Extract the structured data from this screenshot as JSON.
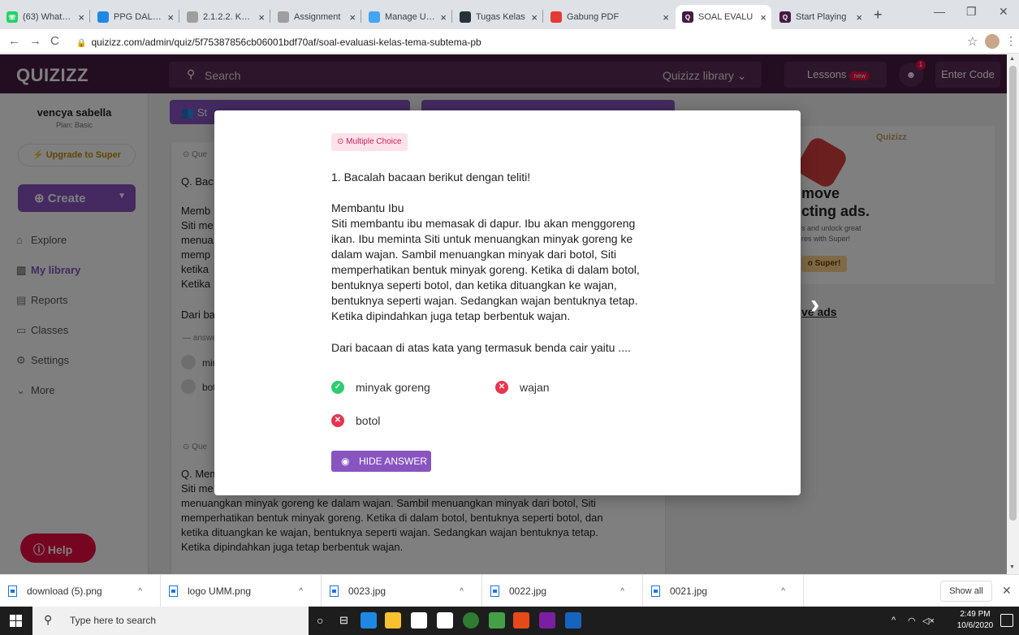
{
  "browser": {
    "tabs": [
      {
        "title": "(63) WhatsAp",
        "color": "#25d366"
      },
      {
        "title": "PPG DALJAB",
        "color": "#1e88e5"
      },
      {
        "title": "2.1.2.2. Konel",
        "color": "#9e9e9e"
      },
      {
        "title": "Assignment",
        "color": "#9e9e9e"
      },
      {
        "title": "Manage Uplo",
        "color": "#42a5f5"
      },
      {
        "title": "Tugas Kelas",
        "color": "#263238"
      },
      {
        "title": "Gabung PDF",
        "color": "#e53935"
      },
      {
        "title": "SOAL EVALU",
        "color": "#461a42"
      },
      {
        "title": "Start Playing",
        "color": "#461a42"
      }
    ],
    "active_tab": 7,
    "url": "quizizz.com/admin/quiz/5f75387856cb06001bdf70af/soal-evaluasi-kelas-tema-subtema-pb"
  },
  "app": {
    "logo": "QUIZIZZ",
    "search_placeholder": "Search",
    "library_label": "Quizizz library",
    "lessons_label": "Lessons",
    "lessons_badge": "new",
    "notification_count": "1",
    "enter_code_label": "Enter Code"
  },
  "sidebar": {
    "user_name": "vencya sabella",
    "plan": "Plan: Basic",
    "upgrade_label": "Upgrade to Super",
    "create_label": "Create",
    "items": [
      {
        "label": "Explore",
        "icon": "explore-icon"
      },
      {
        "label": "My library",
        "icon": "library-icon"
      },
      {
        "label": "Reports",
        "icon": "reports-icon"
      },
      {
        "label": "Classes",
        "icon": "classes-icon"
      },
      {
        "label": "Settings",
        "icon": "settings-icon"
      },
      {
        "label": "More",
        "icon": "chevron-down-icon"
      }
    ],
    "help_label": "Help"
  },
  "background": {
    "toolbar_btn1": "St",
    "card1": {
      "tag": "Que",
      "lines": [
        "Q. Bac",
        "Memb",
        "Siti me",
        "menua",
        "memp",
        "ketika",
        "Ketika",
        "Dari ba"
      ],
      "answer_tag": "answe",
      "options": [
        "min",
        "bot"
      ]
    },
    "card2": {
      "tag": "Que",
      "lines": [
        "Q. Mem",
        "Siti me",
        "menuangkan minyak goreng ke dalam wajan. Sambil menuangkan minyak dari botol, Siti",
        "memperhatikan bentuk minyak goreng. Ketika di dalam botol, bentuknya seperti botol, dan",
        "ketika dituangkan ke wajan, bentuknya seperti wajan. Sedangkan wajan bentuknya tetap.",
        "Ketika dipindahkan juga tetap berbentuk wajan."
      ]
    },
    "ad": {
      "logo": "Quizizz",
      "headline": [
        "move",
        "cting ads."
      ],
      "sub": [
        "s and unlock great",
        "res with Super!"
      ],
      "button": "o Super!",
      "link": "ve ads"
    }
  },
  "modal": {
    "type_label": "Multiple Choice",
    "question_lines": [
      "1. Bacalah bacaan berikut dengan teliti!",
      "",
      "Membantu Ibu",
      "Siti membantu ibu memasak di dapur. Ibu akan menggoreng",
      "ikan. Ibu meminta Siti untuk menuangkan minyak goreng ke",
      "dalam wajan. Sambil menuangkan minyak dari botol, Siti",
      "memperhatikan bentuk minyak goreng. Ketika di dalam botol,",
      "bentuknya seperti botol, dan ketika dituangkan ke wajan,",
      "bentuknya seperti wajan. Sedangkan wajan bentuknya tetap.",
      "Ketika dipindahkan juga tetap berbentuk wajan.",
      "",
      "Dari bacaan di atas kata yang termasuk benda cair yaitu ...."
    ],
    "options": [
      {
        "label": "minyak goreng",
        "correct": true
      },
      {
        "label": "wajan",
        "correct": false
      },
      {
        "label": "botol",
        "correct": false
      }
    ],
    "hide_answer_label": "HIDE ANSWER"
  },
  "downloads": {
    "items": [
      "download (5).png",
      "logo UMM.png",
      "0023.jpg",
      "0022.jpg",
      "0021.jpg"
    ],
    "show_all_label": "Show all"
  },
  "taskbar": {
    "search_placeholder": "Type here to search",
    "time": "2:49 PM",
    "date": "10/6/2020"
  }
}
